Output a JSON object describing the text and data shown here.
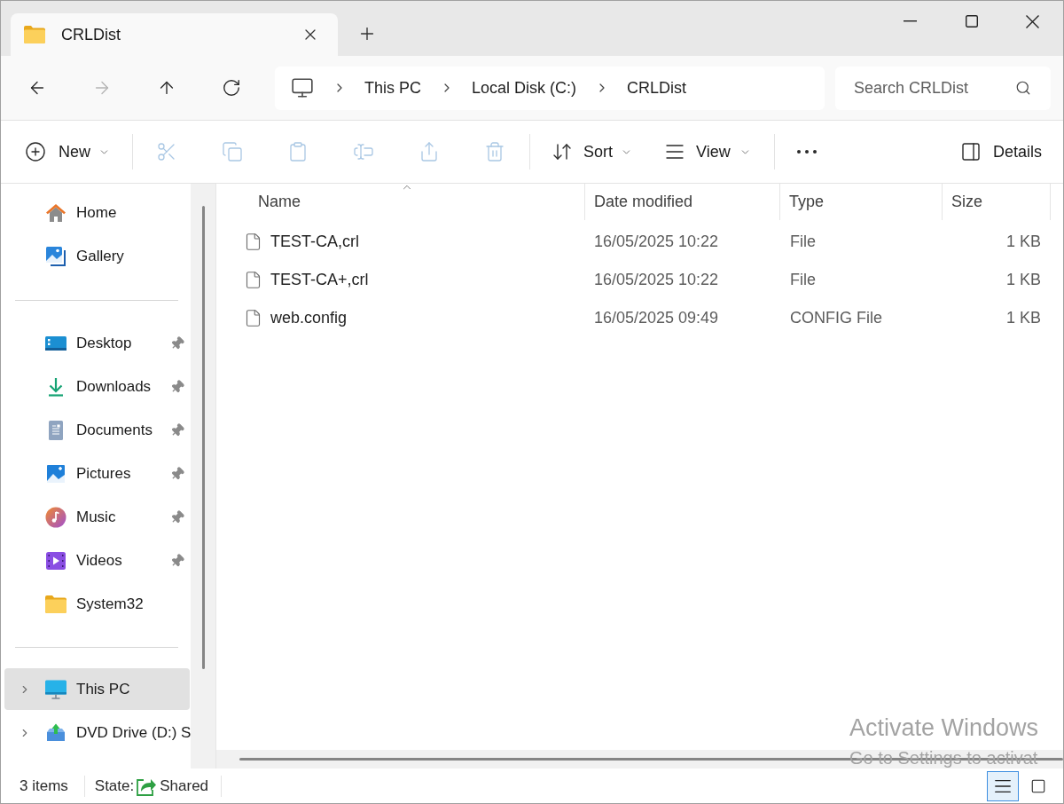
{
  "window": {
    "tabs": [
      {
        "title": "CRLDist",
        "selected": true
      }
    ]
  },
  "navigation": [
    {
      "kind": "back",
      "disabled": false
    },
    {
      "kind": "forward",
      "disabled": true
    },
    {
      "kind": "up",
      "disabled": false
    },
    {
      "kind": "refresh",
      "disabled": false
    }
  ],
  "address_bar": {
    "path": [
      "This PC",
      "Local Disk (C:)",
      "CRLDist"
    ]
  },
  "search": {
    "placeholder": "Search CRLDist"
  },
  "toolbar": {
    "new": {
      "label": "New"
    },
    "actions": [
      {
        "kind": "cut",
        "disabled": true
      },
      {
        "kind": "copy",
        "disabled": true
      },
      {
        "kind": "paste",
        "disabled": true
      },
      {
        "kind": "rename",
        "disabled": true
      },
      {
        "kind": "share",
        "disabled": true
      },
      {
        "kind": "delete",
        "disabled": true
      }
    ],
    "sort": {
      "label": "Sort"
    },
    "view": {
      "label": "View"
    },
    "details": {
      "label": "Details"
    }
  },
  "sidebar": {
    "groups": [
      {
        "items": [
          {
            "kind": "home",
            "label": "Home",
            "pinned": false,
            "expandable": false,
            "selected": false
          },
          {
            "kind": "gallery",
            "label": "Gallery",
            "pinned": false,
            "expandable": false,
            "selected": false
          }
        ]
      },
      {
        "items": [
          {
            "kind": "desktop",
            "label": "Desktop",
            "pinned": true,
            "expandable": false,
            "selected": false
          },
          {
            "kind": "downloads",
            "label": "Downloads",
            "pinned": true,
            "expandable": false,
            "selected": false
          },
          {
            "kind": "documents",
            "label": "Documents",
            "pinned": true,
            "expandable": false,
            "selected": false
          },
          {
            "kind": "pictures",
            "label": "Pictures",
            "pinned": true,
            "expandable": false,
            "selected": false
          },
          {
            "kind": "music",
            "label": "Music",
            "pinned": true,
            "expandable": false,
            "selected": false
          },
          {
            "kind": "videos",
            "label": "Videos",
            "pinned": true,
            "expandable": false,
            "selected": false
          },
          {
            "kind": "folder",
            "label": "System32",
            "pinned": false,
            "expandable": false,
            "selected": false
          }
        ]
      },
      {
        "items": [
          {
            "kind": "this_pc",
            "label": "This PC",
            "pinned": false,
            "expandable": true,
            "selected": true
          },
          {
            "kind": "dvd",
            "label": "DVD Drive (D:) S",
            "pinned": false,
            "expandable": true,
            "selected": false
          }
        ]
      }
    ]
  },
  "table": {
    "columns": [
      {
        "label": "Name",
        "sorted": true
      },
      {
        "label": "Date modified",
        "sorted": false
      },
      {
        "label": "Type",
        "sorted": false
      },
      {
        "label": "Size",
        "sorted": false
      }
    ],
    "rows": [
      {
        "name": "TEST-CA,crl",
        "date_modified": "16/05/2025 10:22",
        "type": "File",
        "size": "1 KB"
      },
      {
        "name": "TEST-CA+,crl",
        "date_modified": "16/05/2025 10:22",
        "type": "File",
        "size": "1 KB"
      },
      {
        "name": "web.config",
        "date_modified": "16/05/2025 09:49",
        "type": "CONFIG File",
        "size": "1 KB"
      }
    ]
  },
  "status_bar": {
    "item_count": "3 items",
    "state_label": "State:",
    "state": "Shared",
    "views": [
      {
        "kind": "details",
        "selected": true
      },
      {
        "kind": "tiles",
        "selected": false
      }
    ]
  },
  "activation_notice": {
    "title": "Activate Windows",
    "subtitle": "Go to Settings to activat"
  }
}
